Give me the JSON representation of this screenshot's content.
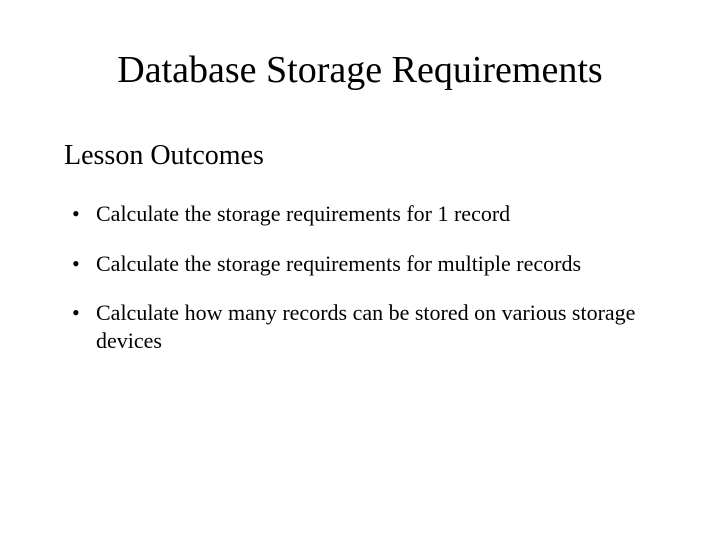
{
  "title": "Database Storage Requirements",
  "subtitle": "Lesson Outcomes",
  "bullets": [
    "Calculate the storage requirements for 1 record",
    "Calculate the storage requirements for multiple records",
    "Calculate how many records can be stored on various storage devices"
  ]
}
